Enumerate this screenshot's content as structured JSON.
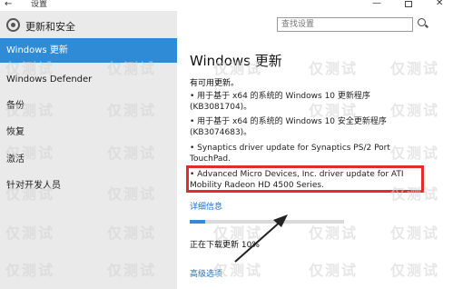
{
  "window": {
    "back_glyph": "←",
    "title": "设置",
    "minimize_glyph": "—",
    "close_glyph": "✕"
  },
  "sidebar": {
    "header_label": "更新和安全",
    "items": [
      {
        "label": "Windows 更新",
        "active": true
      },
      {
        "label": "Windows Defender",
        "active": false
      },
      {
        "label": "备份",
        "active": false
      },
      {
        "label": "恢复",
        "active": false
      },
      {
        "label": "激活",
        "active": false
      },
      {
        "label": "针对开发人员",
        "active": false
      }
    ]
  },
  "search": {
    "placeholder": "查找设置"
  },
  "main": {
    "title": "Windows 更新",
    "status": "有可用更新。",
    "updates": [
      "• 用于基于 x64 的系统的 Windows 10 更新程序 (KB3081704)。",
      "• 用于基于 x64 的系统的 Windows 10 安全更新程序 (KB3074683)。",
      "• Synaptics driver update for Synaptics PS/2 Port TouchPad.",
      "• Advanced Micro Devices, Inc. driver update for ATI Mobility Radeon HD 4500 Series."
    ],
    "details_link": "详细信息",
    "progress_label": "正在下载更新 10%",
    "progress_percent": 10,
    "advanced_link": "高级选项"
  },
  "watermark": {
    "text": "仅测试"
  },
  "colors": {
    "accent": "#2f8bd6",
    "highlight": "#e22b2b",
    "link": "#1b6fc5",
    "sidebar_bg": "#eaeaea"
  }
}
